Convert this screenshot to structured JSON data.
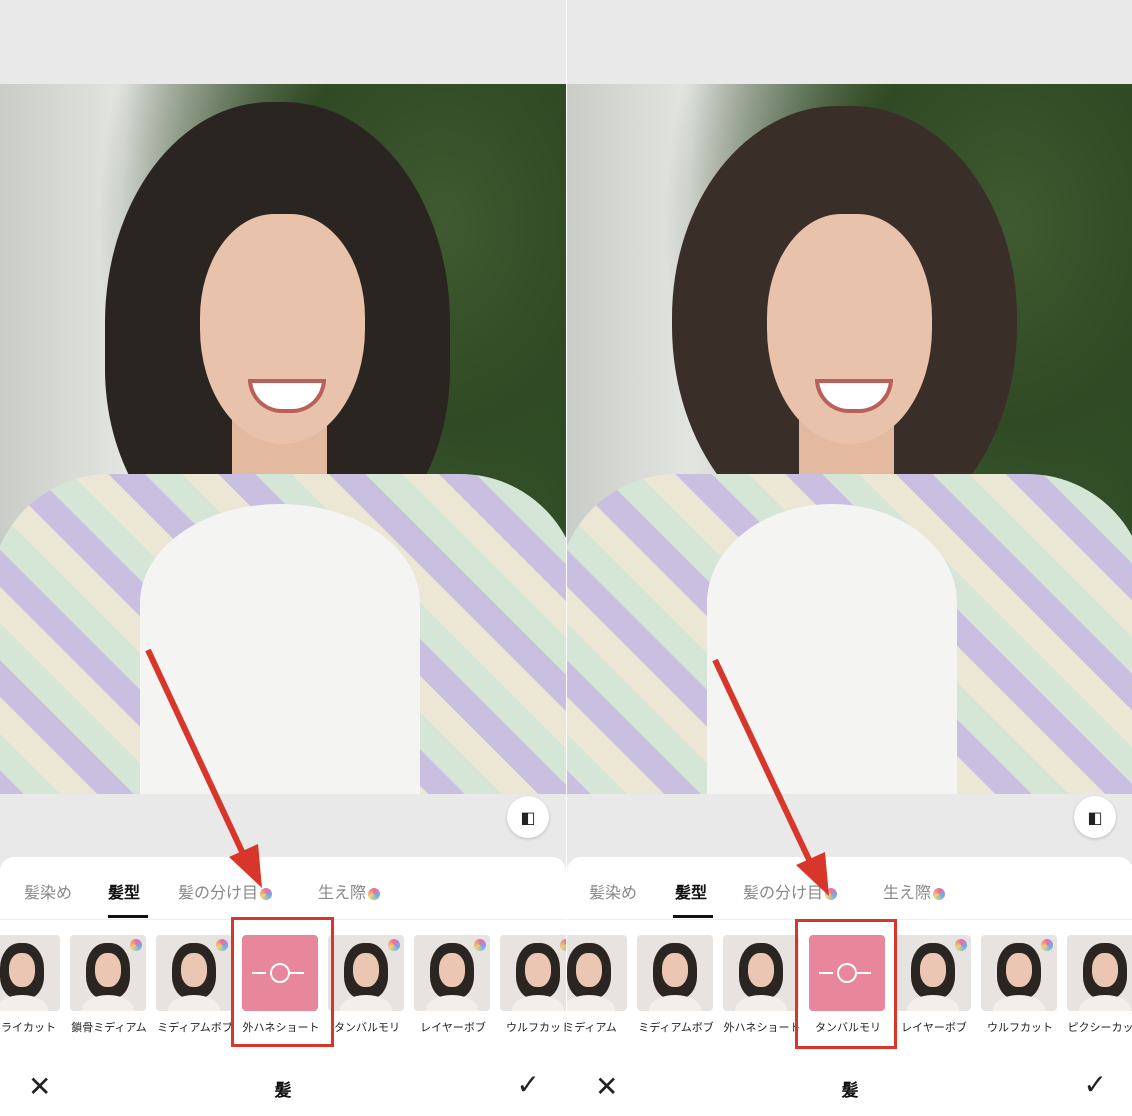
{
  "panels": [
    {
      "tabs": [
        {
          "label": "髪染め",
          "active": false,
          "premium": false
        },
        {
          "label": "髪型",
          "active": true,
          "premium": false
        },
        {
          "label": "髪の分け目",
          "active": false,
          "premium": true
        },
        {
          "label": "生え際",
          "active": false,
          "premium": true
        }
      ],
      "styles": [
        {
          "label": "フライカット",
          "premium": false,
          "selected": false
        },
        {
          "label": "鎖骨ミディアム",
          "premium": true,
          "selected": false
        },
        {
          "label": "ミディアムボブ",
          "premium": true,
          "selected": false
        },
        {
          "label": "外ハネショート",
          "premium": false,
          "selected": true
        },
        {
          "label": "タンバルモリ",
          "premium": true,
          "selected": false
        },
        {
          "label": "レイヤーボブ",
          "premium": true,
          "selected": false
        },
        {
          "label": "ウルフカット",
          "premium": true,
          "selected": false
        }
      ],
      "title": "髪"
    },
    {
      "tabs": [
        {
          "label": "髪染め",
          "active": false,
          "premium": false
        },
        {
          "label": "髪型",
          "active": true,
          "premium": false
        },
        {
          "label": "髪の分け目",
          "active": false,
          "premium": true
        },
        {
          "label": "生え際",
          "active": false,
          "premium": true
        }
      ],
      "styles": [
        {
          "label": "ミディアム",
          "premium": false,
          "selected": false
        },
        {
          "label": "ミディアムボブ",
          "premium": false,
          "selected": false
        },
        {
          "label": "外ハネショート",
          "premium": false,
          "selected": false
        },
        {
          "label": "タンバルモリ",
          "premium": false,
          "selected": true
        },
        {
          "label": "レイヤーボブ",
          "premium": true,
          "selected": false
        },
        {
          "label": "ウルフカット",
          "premium": true,
          "selected": false
        },
        {
          "label": "ピクシーカット",
          "premium": false,
          "selected": false
        }
      ],
      "title": "髪"
    }
  ],
  "icons": {
    "close": "close-icon",
    "confirm": "check-icon",
    "compare": "compare-icon",
    "premium": "gem-icon"
  },
  "colors": {
    "highlight": "#d9362b",
    "selected_thumb": "#e8879c"
  }
}
